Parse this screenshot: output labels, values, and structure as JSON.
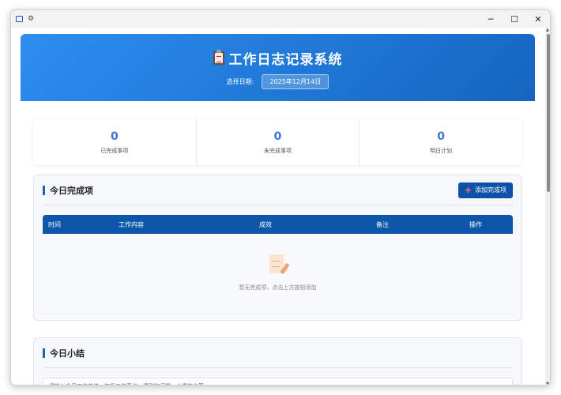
{
  "window": {
    "controls": {
      "minimize": "─",
      "maximize": "☐",
      "close": "✕"
    }
  },
  "header": {
    "title": "工作日志记录系统",
    "date_label": "选择日期:",
    "date_value": "2025年12月14日"
  },
  "stats": [
    {
      "value": "0",
      "label": "已完成事项"
    },
    {
      "value": "0",
      "label": "未完成事项"
    },
    {
      "value": "0",
      "label": "明日计划"
    }
  ],
  "done_panel": {
    "title": "今日完成项",
    "add_button": "添加完成项",
    "columns": [
      "时间",
      "工作内容",
      "成效",
      "备注",
      "操作"
    ],
    "empty_text": "暂无完成项，点击上方按钮添加"
  },
  "summary_panel": {
    "title": "今日小结",
    "placeholder": "请输入今日工作总结，包括工作亮点、遇到的问题、心得体会等..."
  },
  "colors": {
    "header_start": "#2d8ef0",
    "header_end": "#1565c0",
    "accent": "#0d52a6",
    "stat_number": "#3a76d8"
  }
}
